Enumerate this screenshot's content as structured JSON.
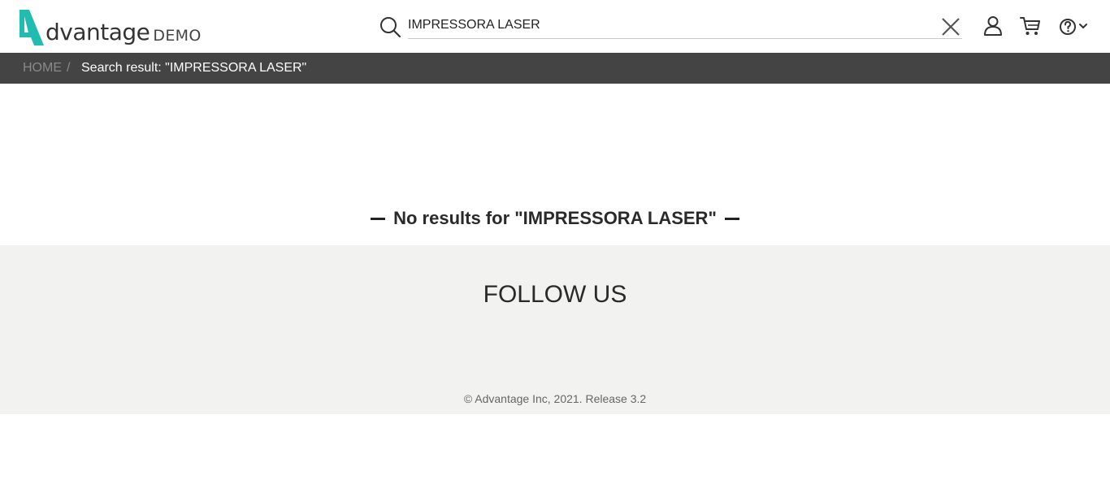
{
  "header": {
    "logo_word": "dvantage",
    "logo_demo": "DEMO",
    "brand_color": "#1ebdb0",
    "search": {
      "value": "IMPRESSORA LASER",
      "placeholder": ""
    },
    "icons": [
      "search-icon",
      "close-icon",
      "user-icon",
      "cart-icon",
      "help-icon",
      "chevron-down-icon"
    ]
  },
  "breadcrumb": {
    "home": "HOME",
    "separator": "/",
    "current": "Search result: \"IMPRESSORA LASER\""
  },
  "main": {
    "no_results": "No results for \"IMPRESSORA LASER\""
  },
  "footer": {
    "follow": "FOLLOW US",
    "copyright": "© Advantage Inc, 2021. Release 3.2"
  }
}
